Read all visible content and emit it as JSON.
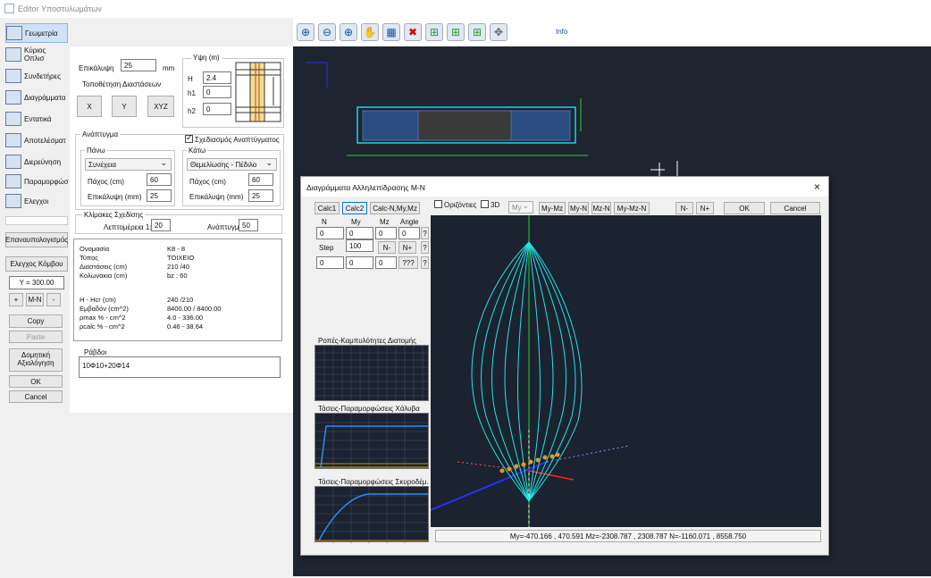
{
  "window": {
    "title": "Editor Υποστυλωμάτων"
  },
  "nav": {
    "items": [
      "Γεωμετρία",
      "Κύριος Οπλισ",
      "Συνδετήρες",
      "Διαγράμματα",
      "Εντατικά",
      "Αποτελέσματ",
      "Διερεύνηση",
      "Παραμορφώσ",
      "Ελεγχοι"
    ]
  },
  "left_buttons": {
    "recalc": "Επαναυπολογισμός",
    "check": "Ελεγχος Κόμβου",
    "y_value": "Y = 300.00",
    "plus": "+",
    "mn": "M-N",
    "minus": "-",
    "copy": "Copy",
    "paste": "Paste",
    "assess": "Δομητική Αξιολόγηση",
    "ok": "OK",
    "cancel": "Cancel"
  },
  "form": {
    "cover_label": "Επικάλυψη",
    "cover_value": "25",
    "cover_unit": "mm",
    "dims_title": "Τοποθέτηση Διαστάσεων",
    "btn_x": "X",
    "btn_y": "Y",
    "btn_xyz": "XYZ",
    "heights_title": "Υψη (m)",
    "h_label": "H",
    "h_value": "2.4",
    "h1_label": "h1",
    "h1_value": "0",
    "h2_label": "h2",
    "h2_value": "0",
    "anaptygma_title": "Ανάπτυγμα",
    "draw_check_label": "Σχεδιασμός Αναπτύγματος",
    "top_title": "Πάνω",
    "top_select": "Συνέχεια",
    "top_thick_label": "Πάχος (cm)",
    "top_thick_value": "60",
    "top_cover_label": "Επικάλυψη (mm)",
    "top_cover_value": "25",
    "bottom_title": "Κάτω",
    "bottom_select": "Θεμελίωσης - Πέδιλο",
    "bottom_thick_label": "Πάχος (cm)",
    "bottom_thick_value": "60",
    "bottom_cover_label": "Επικάλυψη (mm)",
    "bottom_cover_value": "25",
    "scales_title": "Κλίμακες Σχεδίσης",
    "detail_label": "Λεπτομέρεια 1:",
    "detail_value": "20",
    "anapt_label": "Ανάπτυγμα 1:",
    "anapt_value": "50"
  },
  "info": {
    "rows": [
      [
        "Ονομασία",
        "K8 - 8"
      ],
      [
        "Τύπος",
        "ΤΟΙΧΕΙΟ"
      ],
      [
        "Διαστάσεις (cm)",
        "210 /40"
      ],
      [
        "Κολωνακια (cm)",
        "bz : 60"
      ],
      [
        "H - Hcr (cm)",
        "240 /210"
      ],
      [
        "Εμβαδόν (cm^2)",
        "8400.00 / 8400.00"
      ],
      [
        "ρmax % - cm^2",
        "4.0 - 336.00"
      ],
      [
        "ρcalc % - cm^2",
        "0.46 - 38.64"
      ]
    ],
    "rabdoi_title": "Ράβδοι",
    "rabdoi_value": "10Φ10+20Φ14"
  },
  "toolbar": {
    "info_label": "Info"
  },
  "dialog": {
    "title": "Διαγράμματα Αλληλεπίδρασης M-N",
    "close": "×",
    "calc1": "Calc1",
    "calc2": "Calc2",
    "calc_n": "Calc-N,My,Mz",
    "horizontal": "Οριζόντιες",
    "threeD": "3D",
    "my_select": "My",
    "my_mz": "My-Mz",
    "my_n": "My-N",
    "mz_n": "Mz-N",
    "my_mz_n": "My-Mz-N",
    "n_minus": "N-",
    "n_plus": "N+",
    "ok": "OK",
    "cancel": "Cancel",
    "col_n": "N",
    "col_my": "My",
    "col_mz": "Mz",
    "col_angle": "Angle",
    "row1": [
      "0",
      "0",
      "0",
      "0"
    ],
    "q": "?",
    "step_label": "Step",
    "step_value": "100",
    "nm": "N-",
    "np": "N+",
    "row2": [
      "0",
      "0",
      "0"
    ],
    "qqq": "???",
    "flow_title": "Ροπές-Καμπυλότητες Διατομής",
    "steel_title": "Τάσεις-Παραμορφώσεις Χάλυβα",
    "concrete_title": "Τάσεις-Παραμορφώσεις Σκυροδέμ.",
    "status": "My=-470.166 , 470.591 Mz=-2308.787 , 2308.787 N=-1160.071 , 8558.750"
  }
}
